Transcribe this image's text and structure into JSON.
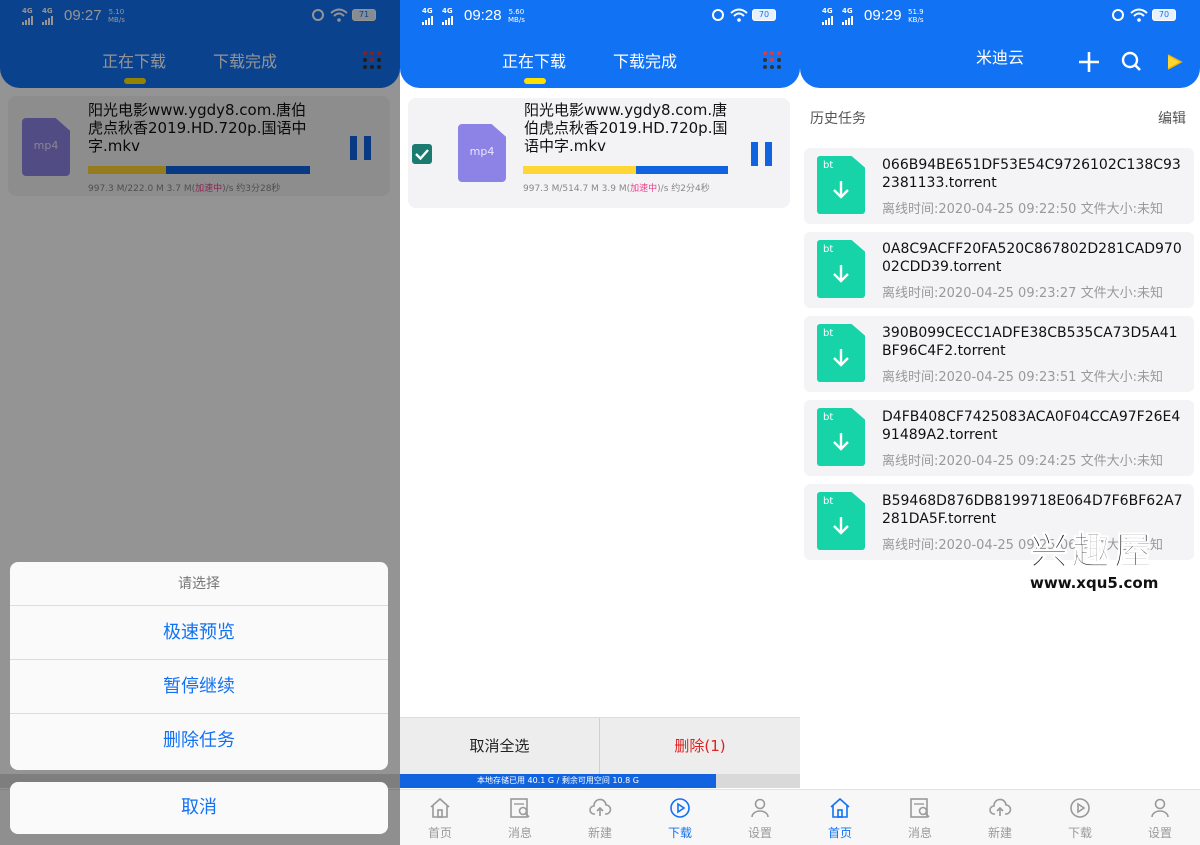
{
  "tabs": {
    "downloading": "正在下载",
    "completed": "下载完成"
  },
  "panel1": {
    "status": {
      "time": "09:27",
      "speed_value": "5.10",
      "speed_unit": "MB/s",
      "battery": "71",
      "network1": "4G",
      "network2": "4G"
    },
    "card": {
      "file_type": "mp4",
      "title": "阳光电影www.ygdy8.com.唐伯虎点秋香2019.HD.720p.国语中字.mkv",
      "progress_fraction": 0.35,
      "status_prefix": "997.3 M/222.0 M 3.7 M(",
      "status_accel": "加速中",
      "status_suffix": ")/s 约3分28秒"
    },
    "sheet": {
      "title": "请选择",
      "items": [
        "极速预览",
        "暂停继续",
        "删除任务"
      ],
      "cancel": "取消"
    }
  },
  "panel2": {
    "status": {
      "time": "09:28",
      "speed_value": "5.60",
      "speed_unit": "MB/s",
      "battery": "70",
      "network1": "4G",
      "network2": "4G"
    },
    "card": {
      "file_type": "mp4",
      "title": "阳光电影www.ygdy8.com.唐伯虎点秋香2019.HD.720p.国语中字.mkv",
      "progress_fraction": 0.55,
      "status_prefix": "997.3 M/514.7 M 3.9 M(",
      "status_accel": "加速中",
      "status_suffix": ")/s 约2分4秒"
    },
    "actions": {
      "cancel_all": "取消全选",
      "delete": "删除(1)"
    },
    "storage": "本地存储已用 40.1 G / 剩余可用空间 10.8 G",
    "storage_fraction": 0.79
  },
  "panel3": {
    "status": {
      "time": "09:29",
      "speed_value": "51.9",
      "speed_unit": "KB/s",
      "battery": "70",
      "network1": "4G",
      "network2": "4G"
    },
    "title": "米迪云",
    "section_title": "历史任务",
    "edit": "编辑",
    "badge": "bt",
    "history": [
      {
        "name": "066B94BE651DF53E54C9726102C138C932381133.torrent",
        "meta": "离线时间:2020-04-25 09:22:50 文件大小:未知"
      },
      {
        "name": "0A8C9ACFF20FA520C867802D281CAD97002CDD39.torrent",
        "meta": "离线时间:2020-04-25 09:23:27 文件大小:未知"
      },
      {
        "name": "390B099CECC1ADFE38CB535CA73D5A41BF96C4F2.torrent",
        "meta": "离线时间:2020-04-25 09:23:51 文件大小:未知"
      },
      {
        "name": "D4FB408CF7425083ACA0F04CCA97F26E491489A2.torrent",
        "meta": "离线时间:2020-04-25 09:24:25 文件大小:未知"
      },
      {
        "name": "B59468D876DB8199718E064D7F6BF62A7281DA5F.torrent",
        "meta": "离线时间:2020-04-25 09:25:06 文件大小:未知"
      }
    ]
  },
  "nav": [
    "首页",
    "消息",
    "新建",
    "下载",
    "设置"
  ],
  "watermark": {
    "logo": "兴趣屋",
    "url": "www.xqu5.com"
  },
  "colors": {
    "primary": "#1272f4",
    "accent_yellow": "#ffd634",
    "file_purple": "#8d83e6",
    "bt_green": "#17d3a8",
    "delete_red": "#e02020"
  }
}
